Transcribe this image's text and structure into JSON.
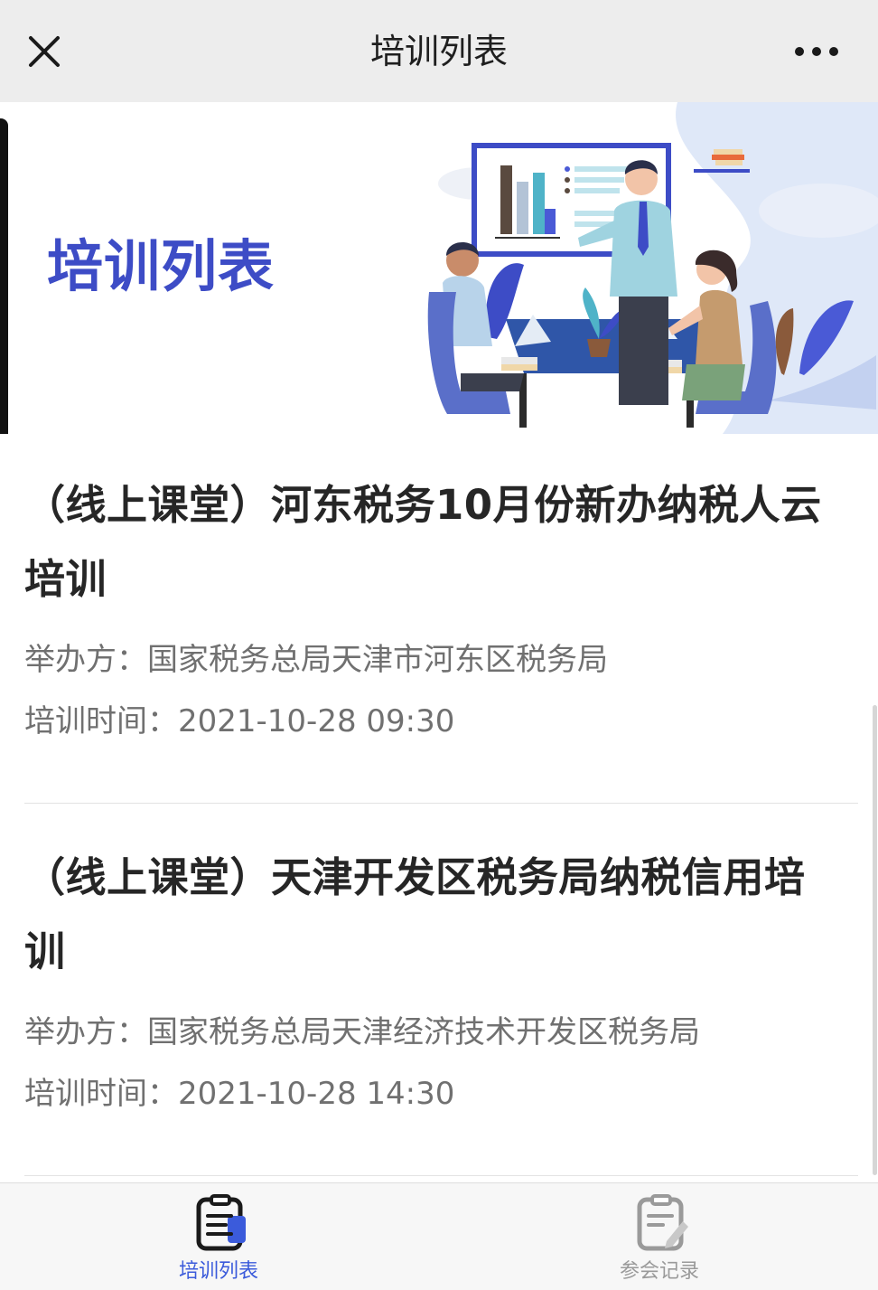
{
  "header": {
    "title": "培训列表",
    "close_icon": "close-icon",
    "more_icon": "more-icon"
  },
  "banner": {
    "title": "培训列表",
    "illustration": "meeting-illustration"
  },
  "trainings": [
    {
      "title": "（线上课堂）河东税务10月份新办纳税人云培训",
      "title_line1": "（线上课堂）河东税务10月份新办纳税人云",
      "title_line2": "培训",
      "organizer": "举办方：国家税务总局天津市河东区税务局",
      "time": "培训时间：2021-10-28 09:30"
    },
    {
      "title": "（线上课堂）天津开发区税务局纳税信用培训",
      "title_line1": "（线上课堂）天津开发区税务局纳税信用培",
      "title_line2": "训",
      "organizer": "举办方：国家税务总局天津经济技术开发区税务局",
      "time": "培训时间：2021-10-28 14:30"
    }
  ],
  "tabbar": {
    "tabs": [
      {
        "label": "培训列表",
        "icon": "list-document-icon",
        "active": true
      },
      {
        "label": "参会记录",
        "icon": "record-edit-icon",
        "active": false
      }
    ],
    "active_color": "#3b5bdb",
    "inactive_color": "#9a9a9a"
  }
}
